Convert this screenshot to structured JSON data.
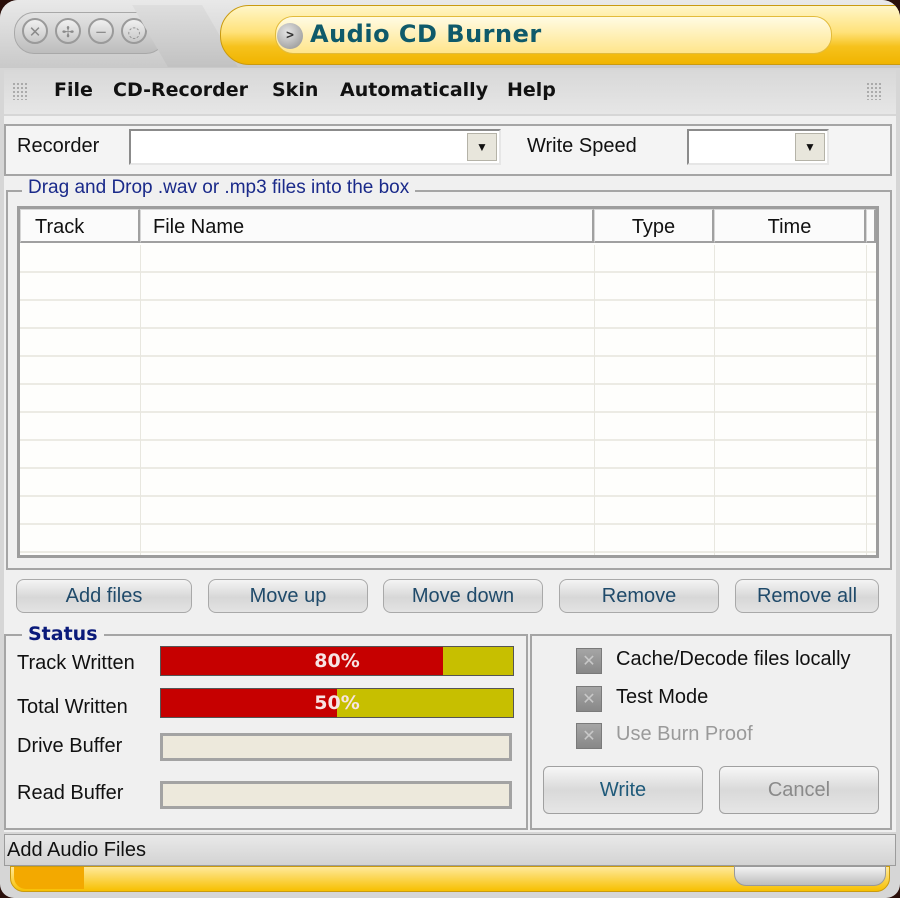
{
  "window": {
    "title": "Audio CD Burner",
    "controls": [
      {
        "name": "close-icon",
        "glyph": "✕"
      },
      {
        "name": "maximize-icon",
        "glyph": "✢"
      },
      {
        "name": "minimize-icon",
        "glyph": "−"
      },
      {
        "name": "restore-icon",
        "glyph": "◌"
      }
    ],
    "title_button_glyph": ">"
  },
  "menu": {
    "items": [
      "File",
      "CD-Recorder",
      "Skin",
      "Automatically",
      "Help"
    ]
  },
  "recorder": {
    "label": "Recorder",
    "value": "",
    "speed_label": "Write Speed",
    "speed_value": "",
    "dropdown_glyph": "▼"
  },
  "tracklist": {
    "group_title": "Drag and Drop .wav or .mp3 files into the box",
    "columns": [
      "Track",
      "File Name",
      "Type",
      "Time"
    ],
    "rows": []
  },
  "buttons": {
    "add_files": "Add files",
    "move_up": "Move up",
    "move_down": "Move down",
    "remove": "Remove",
    "remove_all": "Remove all"
  },
  "status": {
    "title": "Status",
    "track_written_label": "Track Written",
    "track_written_percent": 80,
    "track_written_text": "80%",
    "total_written_label": "Total Written",
    "total_written_percent": 50,
    "total_written_text": "50%",
    "drive_buffer_label": "Drive Buffer",
    "read_buffer_label": "Read Buffer"
  },
  "options": {
    "cache_decode": {
      "label": "Cache/Decode files locally",
      "enabled": true
    },
    "test_mode": {
      "label": "Test Mode",
      "enabled": true
    },
    "burn_proof": {
      "label": "Use Burn Proof",
      "enabled": false
    },
    "checkbox_glyph": "✕"
  },
  "actions": {
    "write": "Write",
    "cancel": "Cancel"
  },
  "statusbar": {
    "text": "Add Audio Files"
  },
  "colors": {
    "title_text": "#0f5a6a",
    "progress_fill": "#c60000",
    "progress_track": "#c7bf00",
    "group_title": "#0a1a7a",
    "button_text": "#1f4a6a",
    "disabled_text": "#9a9a9a"
  }
}
